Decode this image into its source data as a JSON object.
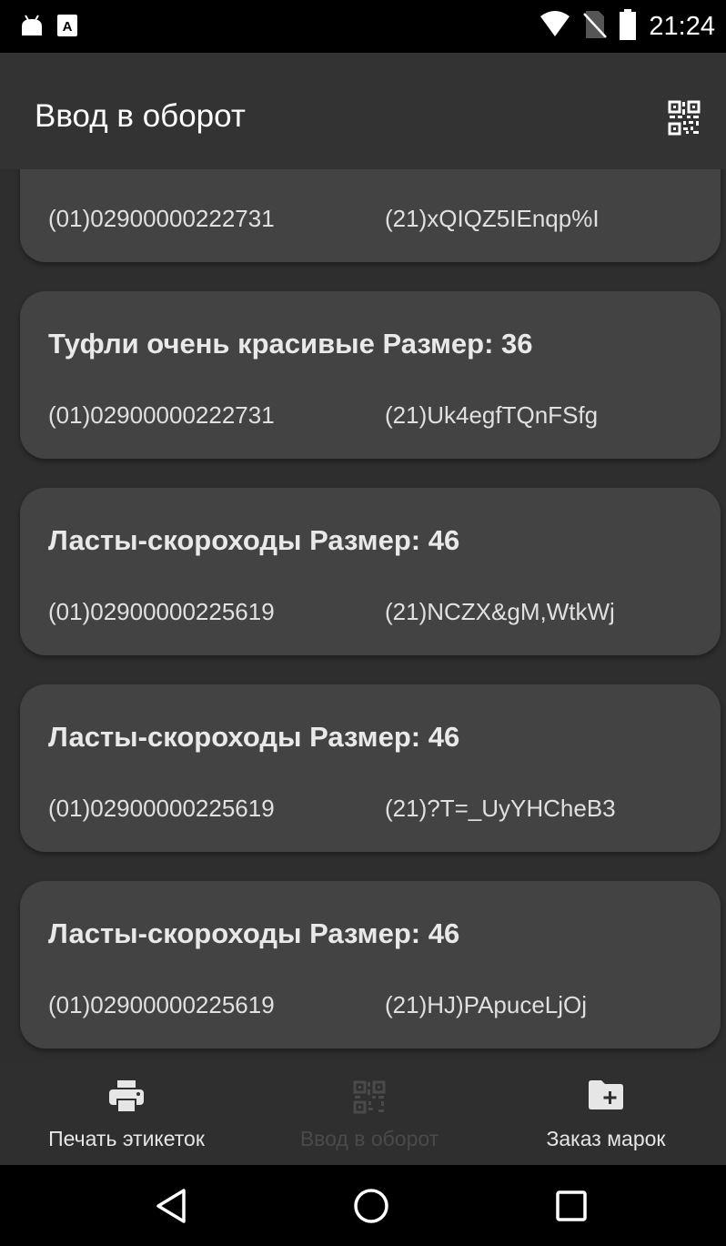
{
  "status_bar": {
    "time": "21:24",
    "icons_left": [
      "android-icon",
      "keyboard-a-icon"
    ],
    "icons_right": [
      "wifi-icon",
      "no-sim-icon",
      "battery-icon"
    ]
  },
  "app_bar": {
    "title": "Ввод в оборот",
    "action_icon": "qr-code-icon"
  },
  "cards": [
    {
      "title": "",
      "gtin": "(01)02900000222731",
      "serial": "(21)xQIQZ5IEnqp%I"
    },
    {
      "title": "Туфли очень красивые Размер: 36",
      "gtin": "(01)02900000222731",
      "serial": "(21)Uk4egfTQnFSfg"
    },
    {
      "title": "Ласты-скороходы Размер: 46",
      "gtin": "(01)02900000225619",
      "serial": "(21)NCZX&gM,WtkWj"
    },
    {
      "title": "Ласты-скороходы Размер: 46",
      "gtin": "(01)02900000225619",
      "serial": "(21)?T=_UyYHCheB3"
    },
    {
      "title": "Ласты-скороходы Размер: 46",
      "gtin": "(01)02900000225619",
      "serial": "(21)HJ)PApuceLjOj"
    }
  ],
  "bottom_nav": {
    "items": [
      {
        "label": "Печать этикеток",
        "icon": "printer-icon",
        "active": true
      },
      {
        "label": "Ввод в оборот",
        "icon": "qr-code-icon",
        "active": false
      },
      {
        "label": "Заказ марок",
        "icon": "folder-add-icon",
        "active": true
      }
    ]
  },
  "colors": {
    "background": "#2e2e2e",
    "card": "#434343",
    "app_bar": "#333333",
    "nav_active": "#e6e6e6",
    "nav_inactive": "#4a4a4a"
  }
}
